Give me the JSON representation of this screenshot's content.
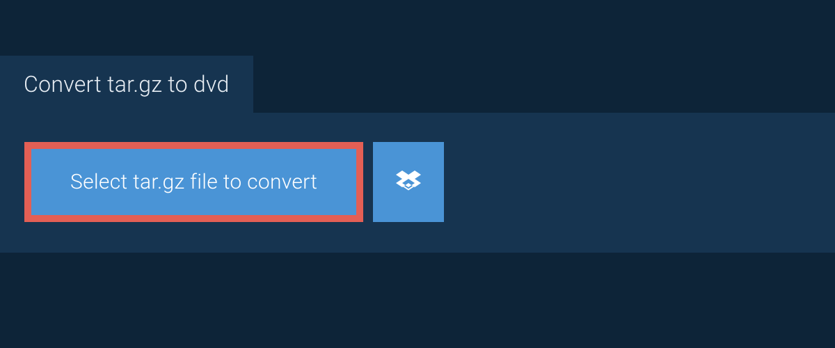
{
  "header": {
    "tab_label": "Convert tar.gz to dvd"
  },
  "actions": {
    "select_file_label": "Select tar.gz file to convert"
  }
}
